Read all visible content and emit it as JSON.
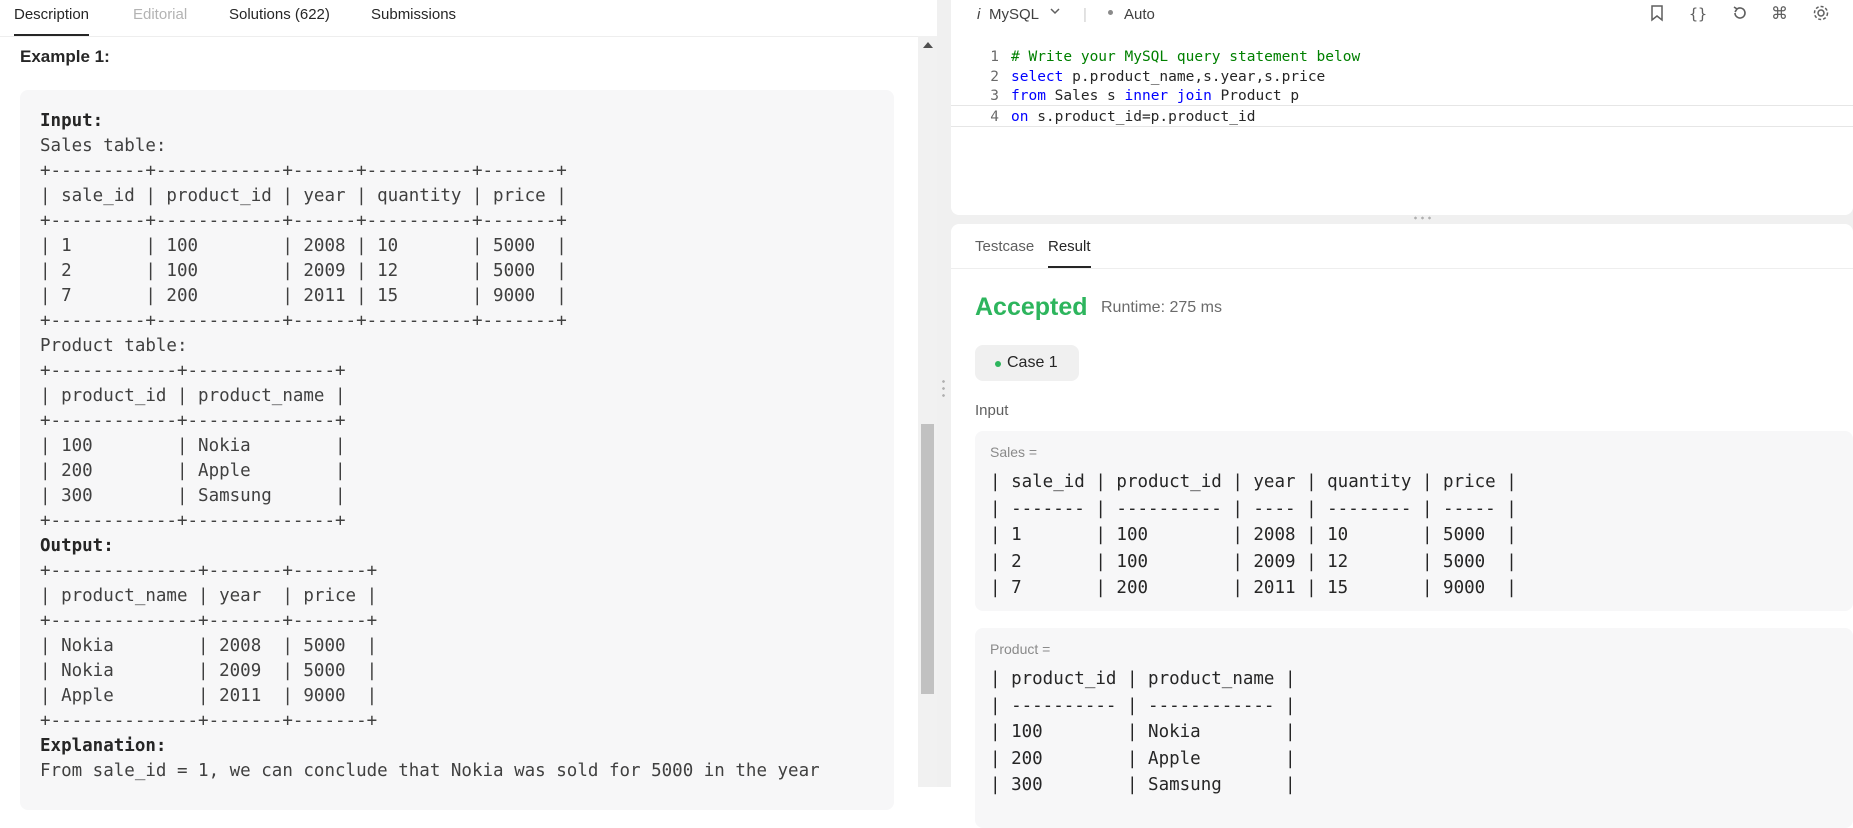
{
  "left_tabs": [
    "Description",
    "Editorial",
    "Solutions (622)",
    "Submissions"
  ],
  "example_title": "Example 1:",
  "example_lines": [
    {
      "text": "Input:",
      "bold": true
    },
    {
      "text": "Sales table:",
      "bold": false
    },
    {
      "text": "+---------+------------+------+----------+-------+",
      "bold": false
    },
    {
      "text": "| sale_id | product_id | year | quantity | price |",
      "bold": false
    },
    {
      "text": "+---------+------------+------+----------+-------+",
      "bold": false
    },
    {
      "text": "| 1       | 100        | 2008 | 10       | 5000  |",
      "bold": false
    },
    {
      "text": "| 2       | 100        | 2009 | 12       | 5000  |",
      "bold": false
    },
    {
      "text": "| 7       | 200        | 2011 | 15       | 9000  |",
      "bold": false
    },
    {
      "text": "+---------+------------+------+----------+-------+",
      "bold": false
    },
    {
      "text": "Product table:",
      "bold": false
    },
    {
      "text": "+------------+--------------+",
      "bold": false
    },
    {
      "text": "| product_id | product_name |",
      "bold": false
    },
    {
      "text": "+------------+--------------+",
      "bold": false
    },
    {
      "text": "| 100        | Nokia        |",
      "bold": false
    },
    {
      "text": "| 200        | Apple        |",
      "bold": false
    },
    {
      "text": "| 300        | Samsung      |",
      "bold": false
    },
    {
      "text": "+------------+--------------+",
      "bold": false
    },
    {
      "text": "Output:",
      "bold": true
    },
    {
      "text": "+--------------+-------+-------+",
      "bold": false
    },
    {
      "text": "| product_name | year  | price |",
      "bold": false
    },
    {
      "text": "+--------------+-------+-------+",
      "bold": false
    },
    {
      "text": "| Nokia        | 2008  | 5000  |",
      "bold": false
    },
    {
      "text": "| Nokia        | 2009  | 5000  |",
      "bold": false
    },
    {
      "text": "| Apple        | 2011  | 9000  |",
      "bold": false
    },
    {
      "text": "+--------------+-------+-------+",
      "bold": false
    },
    {
      "text": "Explanation:",
      "bold": true
    },
    {
      "text": "From sale_id = 1, we can conclude that Nokia was sold for 5000 in the year",
      "bold": false
    }
  ],
  "toolbar": {
    "language": "MySQL",
    "mode": "Auto",
    "language_icon": "i",
    "icons": [
      "bookmark-icon",
      "braces-icon",
      "reset-icon",
      "command-icon",
      "gear-icon"
    ]
  },
  "code_lines": [
    {
      "n": "1",
      "parts": [
        {
          "t": "# Write your MySQL query statement below",
          "c": "cm"
        }
      ]
    },
    {
      "n": "2",
      "parts": [
        {
          "t": "select",
          "c": "kw"
        },
        {
          "t": " p.product_name,s.year,s.price",
          "c": ""
        }
      ]
    },
    {
      "n": "3",
      "parts": [
        {
          "t": "from",
          "c": "kw"
        },
        {
          "t": " Sales s ",
          "c": ""
        },
        {
          "t": "inner join",
          "c": "kw"
        },
        {
          "t": " Product p",
          "c": ""
        }
      ]
    },
    {
      "n": "4",
      "parts": [
        {
          "t": "on",
          "c": "kw"
        },
        {
          "t": " s.product_id=p.product_id",
          "c": ""
        }
      ]
    }
  ],
  "result_tabs": [
    "Testcase",
    "Result"
  ],
  "result": {
    "status": "Accepted",
    "runtime": "Runtime: 275 ms",
    "case_label": "Case 1",
    "input_label": "Input"
  },
  "inputs": [
    {
      "name": "Sales =",
      "lines": [
        "| sale_id | product_id | year | quantity | price |",
        "| ------- | ---------- | ---- | -------- | ----- |",
        "| 1       | 100        | 2008 | 10       | 5000  |",
        "| 2       | 100        | 2009 | 12       | 5000  |",
        "| 7       | 200        | 2011 | 15       | 9000  |"
      ]
    },
    {
      "name": "Product =",
      "lines": [
        "| product_id | product_name |",
        "| ---------- | ------------ |",
        "| 100        | Nokia        |",
        "| 200        | Apple        |",
        "| 300        | Samsung      |"
      ]
    }
  ],
  "colors": {
    "accepted": "#2db55d",
    "keyword": "#0000ff",
    "comment": "#008000"
  }
}
